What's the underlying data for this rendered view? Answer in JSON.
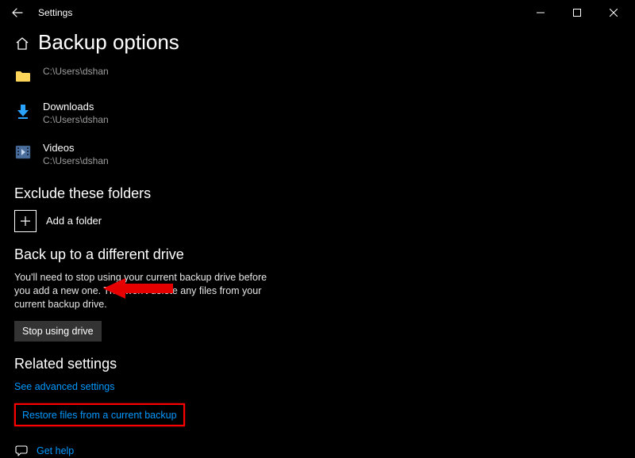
{
  "window": {
    "title": "Settings"
  },
  "header": {
    "page_title": "Backup options"
  },
  "folders": [
    {
      "name": "",
      "path": "C:\\Users\\dshan",
      "icon": "folder"
    },
    {
      "name": "Downloads",
      "path": "C:\\Users\\dshan",
      "icon": "download"
    },
    {
      "name": "Videos",
      "path": "C:\\Users\\dshan",
      "icon": "videos"
    }
  ],
  "exclude": {
    "heading": "Exclude these folders",
    "add_label": "Add a folder"
  },
  "different_drive": {
    "heading": "Back up to a different drive",
    "body": "You'll need to stop using your current backup drive before you add a new one. This won't delete any files from your current backup drive.",
    "button": "Stop using drive"
  },
  "related": {
    "heading": "Related settings",
    "advanced": "See advanced settings",
    "restore": "Restore files from a current backup"
  },
  "help": {
    "label": "Get help"
  }
}
